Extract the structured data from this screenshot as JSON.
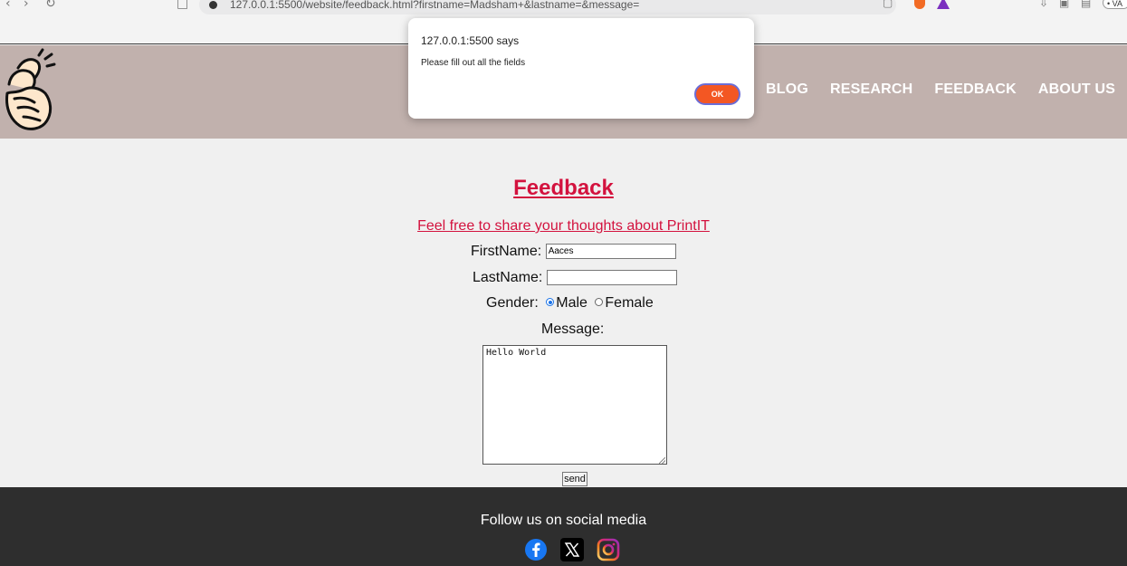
{
  "browser": {
    "url": "127.0.0.1:5500/website/feedback.html?firstname=Madsham+&lastname=&message=",
    "profile_label": "• VA"
  },
  "header": {
    "nav": [
      "BLOG",
      "RESEARCH",
      "FEEDBACK",
      "ABOUT US"
    ]
  },
  "form": {
    "title": "Feedback",
    "subtitle": "Feel free to share your thoughts about PrintIT",
    "firstname_label": "FirstName:",
    "firstname_value": "Aaces",
    "lastname_label": "LastName:",
    "lastname_value": "",
    "gender_label": "Gender:",
    "gender_options": [
      "Male",
      "Female"
    ],
    "gender_selected": "Male",
    "message_label": "Message:",
    "message_value": "Hello World",
    "send_label": "send"
  },
  "footer": {
    "text": "Follow us on social media",
    "icons": [
      "facebook-icon",
      "x-icon",
      "instagram-icon"
    ]
  },
  "dialog": {
    "title": "127.0.0.1:5500 says",
    "message": "Please fill out all the fields",
    "ok_label": "OK"
  },
  "colors": {
    "header_bg": "#c1b1ad",
    "accent_red": "#d3123e",
    "footer_bg": "#2e2e2e",
    "ok_button": "#f35723"
  }
}
